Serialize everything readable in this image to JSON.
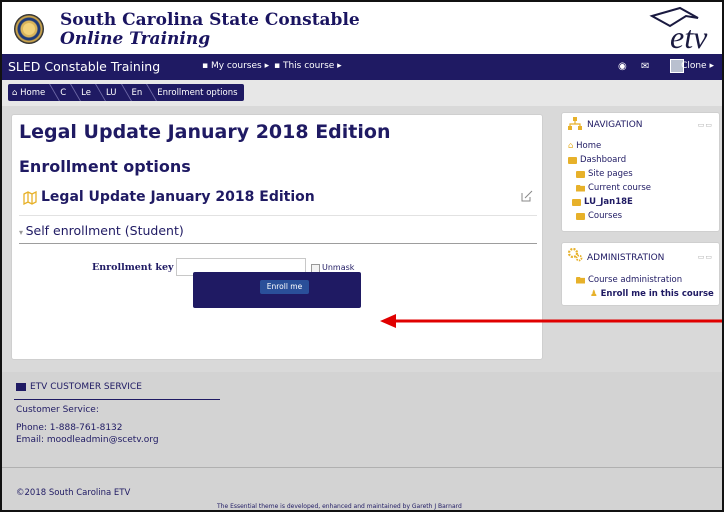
{
  "banner": {
    "line1": "South Carolina State Constable",
    "line2": "Online Training",
    "logo_text": "etv"
  },
  "navbar": {
    "site_name": "SLED Constable Training",
    "my_courses": "My courses",
    "this_course": "This course",
    "user_label": "Clone"
  },
  "breadcrumb": [
    "Home",
    "C",
    "Le",
    "LU",
    "En",
    "Enrollment options"
  ],
  "main": {
    "page_title": "Legal Update January 2018 Edition",
    "sub_title": "Enrollment options",
    "course_name": "Legal Update January 2018 Edition",
    "self_enrolment": "Self enrollment (Student)",
    "key_label": "Enrollment key",
    "key_value": "",
    "unmask_label": "Unmask",
    "enrol_button": "Enroll me"
  },
  "navigation_block": {
    "title": "NAVIGATION",
    "items": [
      "Home",
      "Dashboard",
      "Site pages",
      "Current course",
      "LU_Jan18E",
      "Courses"
    ]
  },
  "admin_block": {
    "title": "ADMINISTRATION",
    "items": [
      "Course administration",
      "Enroll me in this course"
    ]
  },
  "footer": {
    "heading": "ETV CUSTOMER SERVICE",
    "service_label": "Customer Service:",
    "phone": "Phone: 1-888-761-8132",
    "email": "Email: moodleadmin@scetv.org",
    "copyright": "©2018 South Carolina ETV",
    "credit": "The Essential theme is developed, enhanced and maintained by Gareth J Barnard"
  },
  "colors": {
    "brand_navy": "#1f1a63",
    "arrow_red": "#e00000",
    "folder_yellow": "#e7b12a"
  }
}
